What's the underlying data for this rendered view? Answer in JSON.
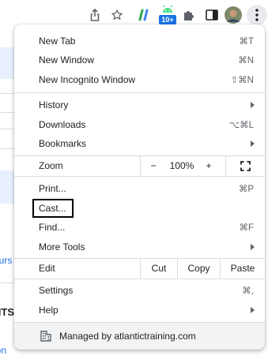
{
  "toolbar": {
    "icons": [
      "share-icon",
      "star-icon",
      "extension-stripe-icon",
      "android-extension-icon",
      "puzzle-extensions-icon",
      "side-panel-icon",
      "profile-avatar",
      "kebab-menu-icon"
    ],
    "badge": "10+",
    "colors": {
      "badge_bg": "#1a73e8",
      "stripe_green": "#34a853",
      "stripe_blue": "#4285f4"
    }
  },
  "background": {
    "fragments": [
      "ours",
      "NTS",
      "ion"
    ]
  },
  "menu": {
    "section1": [
      {
        "label": "New Tab",
        "shortcut": "⌘T"
      },
      {
        "label": "New Window",
        "shortcut": "⌘N"
      },
      {
        "label": "New Incognito Window",
        "shortcut": "⇧⌘N"
      }
    ],
    "section2": [
      {
        "label": "History",
        "submenu": true
      },
      {
        "label": "Downloads",
        "shortcut": "⌥⌘L"
      },
      {
        "label": "Bookmarks",
        "submenu": true
      }
    ],
    "zoom": {
      "label": "Zoom",
      "minus": "−",
      "value": "100%",
      "plus": "+"
    },
    "section3": [
      {
        "label": "Print...",
        "shortcut": "⌘P"
      },
      {
        "label": "Cast...",
        "focused": true
      },
      {
        "label": "Find...",
        "shortcut": "⌘F"
      },
      {
        "label": "More Tools",
        "submenu": true
      }
    ],
    "edit": {
      "label": "Edit",
      "cut": "Cut",
      "copy": "Copy",
      "paste": "Paste"
    },
    "section4": [
      {
        "label": "Settings",
        "shortcut": "⌘,"
      },
      {
        "label": "Help",
        "submenu": true
      }
    ],
    "managed": {
      "label": "Managed by atlantictraining.com",
      "icon": "building-icon"
    }
  }
}
